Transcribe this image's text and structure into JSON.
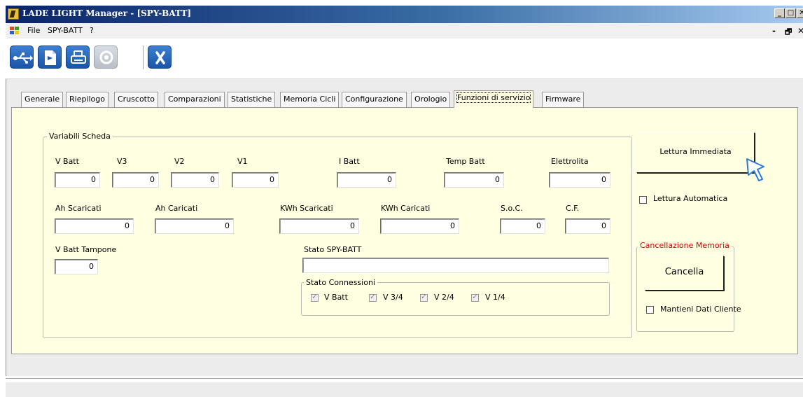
{
  "window": {
    "title": "LADE LIGHT Manager - [SPY-BATT]",
    "min": "_",
    "max": "□",
    "close": "✕"
  },
  "menu": {
    "items": [
      "File",
      "SPY-BATT",
      "?"
    ],
    "mdi_min": "-",
    "mdi_restore": "🗗",
    "mdi_close": "✕"
  },
  "toolbar": {
    "buttons": [
      "usb-connect-icon",
      "export-document-icon",
      "print-icon",
      "refresh-icon",
      "close-x-icon"
    ]
  },
  "tabs": [
    "Generale",
    "Riepilogo",
    "Cruscotto",
    "Comparazioni",
    "Statistiche",
    "Memoria Cicli",
    "Configurazione",
    "Orologio",
    "Funzioni di servizio",
    "Firmware"
  ],
  "active_tab": "Funzioni di servizio",
  "variabili": {
    "legend": "Variabili Scheda",
    "row1": [
      {
        "label": "V Batt",
        "value": "0"
      },
      {
        "label": "V3",
        "value": "0"
      },
      {
        "label": "V2",
        "value": "0"
      },
      {
        "label": "V1",
        "value": "0"
      },
      {
        "label": "I Batt",
        "value": "0"
      },
      {
        "label": "Temp Batt",
        "value": "0"
      },
      {
        "label": "Elettrolita",
        "value": "0"
      }
    ],
    "row2": [
      {
        "label": "Ah Scaricati",
        "value": "0"
      },
      {
        "label": "Ah Caricati",
        "value": "0"
      },
      {
        "label": "KWh Scaricati",
        "value": "0"
      },
      {
        "label": "KWh Caricati",
        "value": "0"
      },
      {
        "label": "S.o.C.",
        "value": "0"
      },
      {
        "label": "C.F.",
        "value": "0"
      }
    ],
    "tampone": {
      "label": "V Batt Tampone",
      "value": "0"
    },
    "stato": {
      "label": "Stato SPY-BATT",
      "value": ""
    },
    "connessioni": {
      "legend": "Stato Connessioni",
      "items": [
        "V Batt",
        "V 3/4",
        "V 2/4",
        "V 1/4"
      ],
      "checked": true
    }
  },
  "lettura": {
    "button": "Lettura Immediata",
    "auto": "Lettura Automatica"
  },
  "cancellazione": {
    "legend": "Cancellazione Memoria",
    "legend_color": "#cc0000",
    "button": "Cancella",
    "keep": "Mantieni Dati Cliente"
  }
}
